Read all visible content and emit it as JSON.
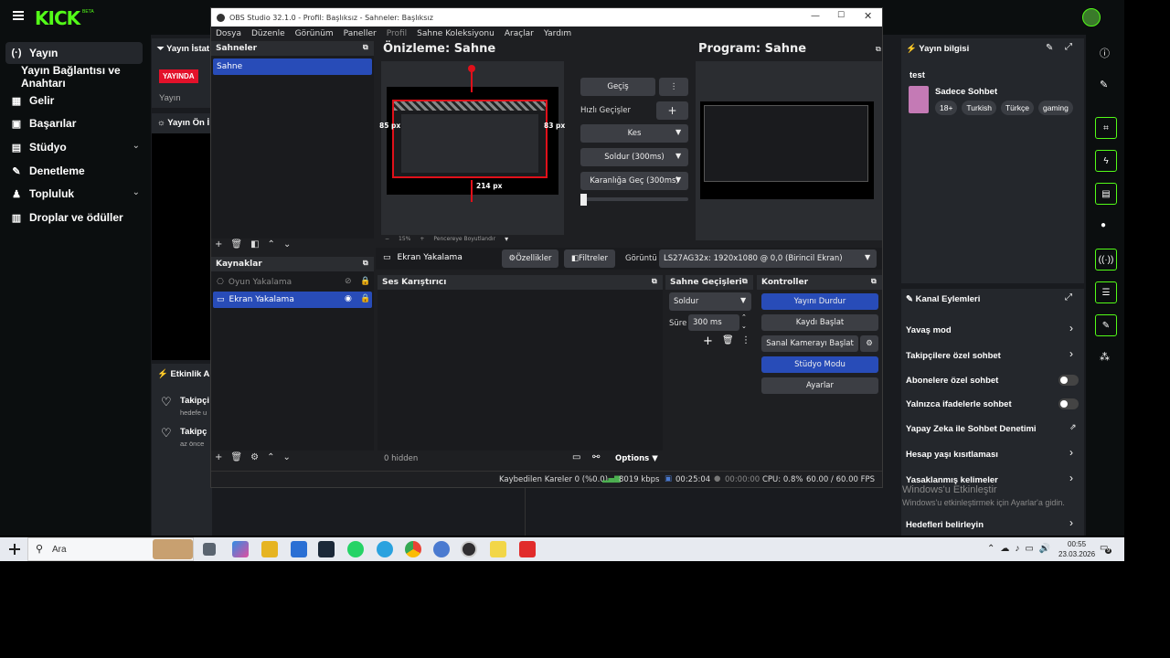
{
  "kick": {
    "logo": "KICK",
    "logo_beta": "BETA",
    "sidebar": {
      "items": [
        {
          "label": "Yayın",
          "icon": "broadcast-icon"
        },
        {
          "label": "Yayın Bağlantısı ve Anahtarı",
          "icon": ""
        },
        {
          "label": "Gelir",
          "icon": "revenue-icon"
        },
        {
          "label": "Başarılar",
          "icon": "trophy-icon"
        },
        {
          "label": "Stüdyo",
          "icon": "studio-icon"
        },
        {
          "label": "Denetleme",
          "icon": "wrench-icon"
        },
        {
          "label": "Topluluk",
          "icon": "community-icon"
        },
        {
          "label": "Droplar ve ödüller",
          "icon": "drops-icon"
        }
      ]
    },
    "stats_title": "Yayın İstat",
    "live_badge": "YAYINDA",
    "stream_label": "Yayın",
    "preview_title": "Yayın Ön İ",
    "activity": {
      "title": "Etkinlik Ak",
      "items": [
        {
          "title": "Takipçi",
          "sub": "hedefe u"
        },
        {
          "title": "Takipç",
          "sub": "az önce"
        }
      ]
    },
    "stream_info": {
      "title": "Yayın bilgisi",
      "stream_title": "test",
      "category": "Sadece Sohbet",
      "tags": [
        "18+",
        "Turkish",
        "Türkçe",
        "gaming"
      ]
    },
    "channel_actions": {
      "title": "Kanal Eylemleri",
      "items": [
        {
          "label": "Yavaş mod",
          "control": "arrow"
        },
        {
          "label": "Takipçilere özel sohbet",
          "control": "arrow"
        },
        {
          "label": "Abonelere özel sohbet",
          "control": "toggle"
        },
        {
          "label": "Yalnızca ifadelerle sohbet",
          "control": "toggle"
        },
        {
          "label": "Yapay Zeka ile Sohbet Denetimi",
          "control": "external"
        },
        {
          "label": "Hesap yaşı kısıtlaması",
          "control": "arrow"
        },
        {
          "label": "Yasaklanmış kelimeler",
          "control": "arrow"
        },
        {
          "label": "Hedefleri belirleyin",
          "control": "arrow"
        }
      ]
    },
    "watermark": {
      "title": "Windows'u Etkinleştir",
      "sub": "Windows'u etkinleştirmek için Ayarlar'a gidin."
    },
    "brand_color": "#53fc18"
  },
  "obs": {
    "title": "OBS Studio 32.1.0 - Profil: Başlıksız - Sahneler: Başlıksız",
    "menu": [
      "Dosya",
      "Düzenle",
      "Görünüm",
      "Paneller",
      "Profil",
      "Sahne Koleksiyonu",
      "Araçlar",
      "Yardım"
    ],
    "scenes_title": "Sahneler",
    "scenes": [
      "Sahne"
    ],
    "sources_title": "Kaynaklar",
    "sources": [
      "Oyun Yakalama",
      "Ekran Yakalama"
    ],
    "preview_title": "Önizleme: Sahne",
    "program_title": "Program: Sahne",
    "px_labels": {
      "left": "85 px",
      "right": "83 px",
      "bottom": "214 px"
    },
    "zoom": {
      "percent": "15%",
      "mode": "Pencereye Boyutlandır"
    },
    "transition": {
      "button": "Geçiş",
      "quick_label": "Hızlı Geçişler",
      "items": [
        "Kes",
        "Soldur (300ms)",
        "Karanlığa Geç (300ms)"
      ]
    },
    "source_bar": {
      "name": "Ekran Yakalama",
      "properties": "Özellikler",
      "filters": "Filtreler",
      "display_label": "Görüntü",
      "display_value": "LS27AG32x: 1920x1080 @ 0,0 (Birincil Ekran)"
    },
    "mixer": {
      "title": "Ses Karıştırıcı",
      "hidden": "0 hidden",
      "options": "Options"
    },
    "scene_transitions": {
      "title": "Sahne Geçişleri",
      "value": "Soldur",
      "duration_label": "Süre",
      "duration": "300 ms"
    },
    "controls": {
      "title": "Kontroller",
      "buttons": [
        "Yayını Durdur",
        "Kaydı Başlat",
        "Sanal Kamerayı Başlat",
        "Stüdyo Modu",
        "Ayarlar"
      ]
    },
    "status": {
      "dropped": "Kaybedilen Kareler 0 (%0.0)",
      "bitrate": "8019 kbps",
      "stream_time": "00:25:04",
      "rec_time": "00:00:00",
      "cpu": "CPU: 0.8%",
      "fps": "60.00 / 60.00 FPS"
    }
  },
  "taskbar": {
    "search": "Ara",
    "time": "00:55",
    "date": "23.03.2026",
    "notification_count": "9"
  }
}
